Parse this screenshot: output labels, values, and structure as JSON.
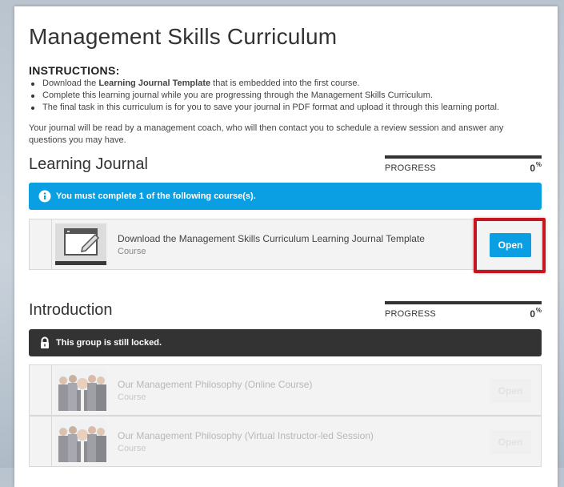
{
  "page": {
    "title": "Management Skills Curriculum"
  },
  "instructions": {
    "heading": "INSTRUCTIONS:",
    "items": [
      {
        "before": "Download the ",
        "bold": "Learning Journal Template",
        "after": " that is embedded into the first course."
      },
      {
        "before": "Complete this learning journal while you are progressing through the Management Skills Curriculum.",
        "bold": "",
        "after": ""
      },
      {
        "before": "The final task in this curriculum is for you to save your journal in PDF format and upload it through this learning portal.",
        "bold": "",
        "after": ""
      }
    ],
    "note": "Your journal will be read by a management coach, who will then contact you to schedule a review session and answer any questions you may have."
  },
  "groups": [
    {
      "title": "Learning Journal",
      "progress_label": "PROGRESS",
      "progress_value": "0",
      "progress_unit": "%",
      "banner_text": "You must complete 1 of the following course(s).",
      "banner_color": "#0a9fe3",
      "courses": [
        {
          "title": "Download the Management Skills Curriculum Learning Journal Template",
          "type": "Course",
          "button": "Open"
        }
      ]
    },
    {
      "title": "Introduction",
      "progress_label": "PROGRESS",
      "progress_value": "0",
      "progress_unit": "%",
      "banner_text": "This group is still locked.",
      "banner_color": "#333333",
      "courses": [
        {
          "title": "Our Management Philosophy (Online Course)",
          "type": "Course",
          "button": "Open"
        },
        {
          "title": "Our Management Philosophy (Virtual Instructor-led Session)",
          "type": "Course",
          "button": "Open"
        }
      ]
    }
  ],
  "icons": {
    "info": "info-icon",
    "lock": "lock-icon",
    "journal": "notebook-pencil-icon",
    "people": "business-people-photo"
  },
  "colors": {
    "accent": "#0a9fe3",
    "highlight": "#c8141e",
    "dark": "#333333"
  }
}
